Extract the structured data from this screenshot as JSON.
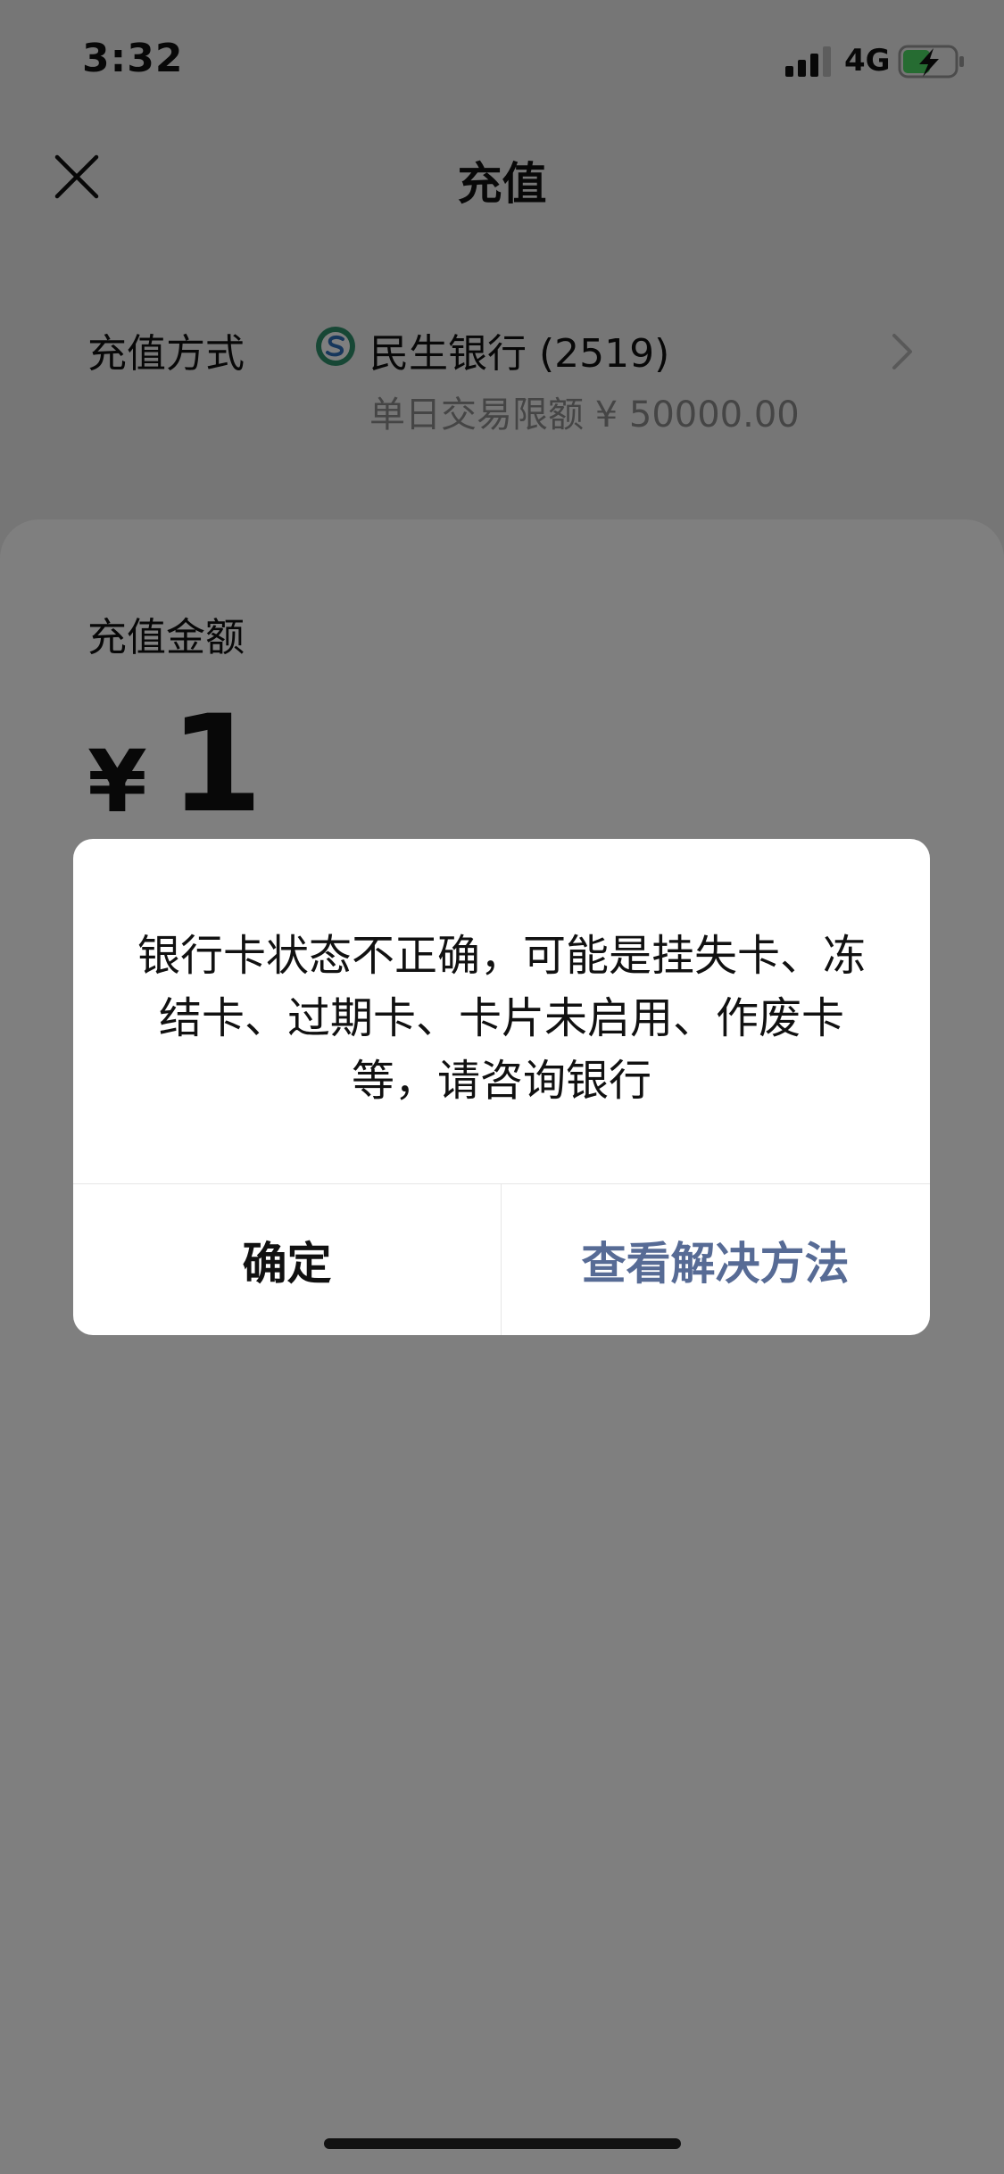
{
  "status_bar": {
    "time": "3:32",
    "network": "4G"
  },
  "nav": {
    "title": "充值"
  },
  "payment_method": {
    "label": "充值方式",
    "bank_name": "民生银行 (2519)",
    "limit_text": "单日交易限额 ¥ 50000.00"
  },
  "amount": {
    "label": "充值金额",
    "currency": "¥",
    "value": "1"
  },
  "dialog": {
    "message": "银行卡状态不正确，可能是挂失卡、冻结卡、过期卡、卡片未启用、作废卡等，请咨询银行",
    "confirm_label": "确定",
    "solution_label": "查看解决方法"
  },
  "colors": {
    "link": "#576b95",
    "background": "#ededed",
    "mask": "rgba(0,0,0,0.5)"
  },
  "icons": {
    "close": "close-icon",
    "signal": "signal-icon",
    "battery": "battery-charging-icon",
    "chevron": "chevron-right-icon",
    "bank": "minsheng-bank-logo-icon"
  }
}
